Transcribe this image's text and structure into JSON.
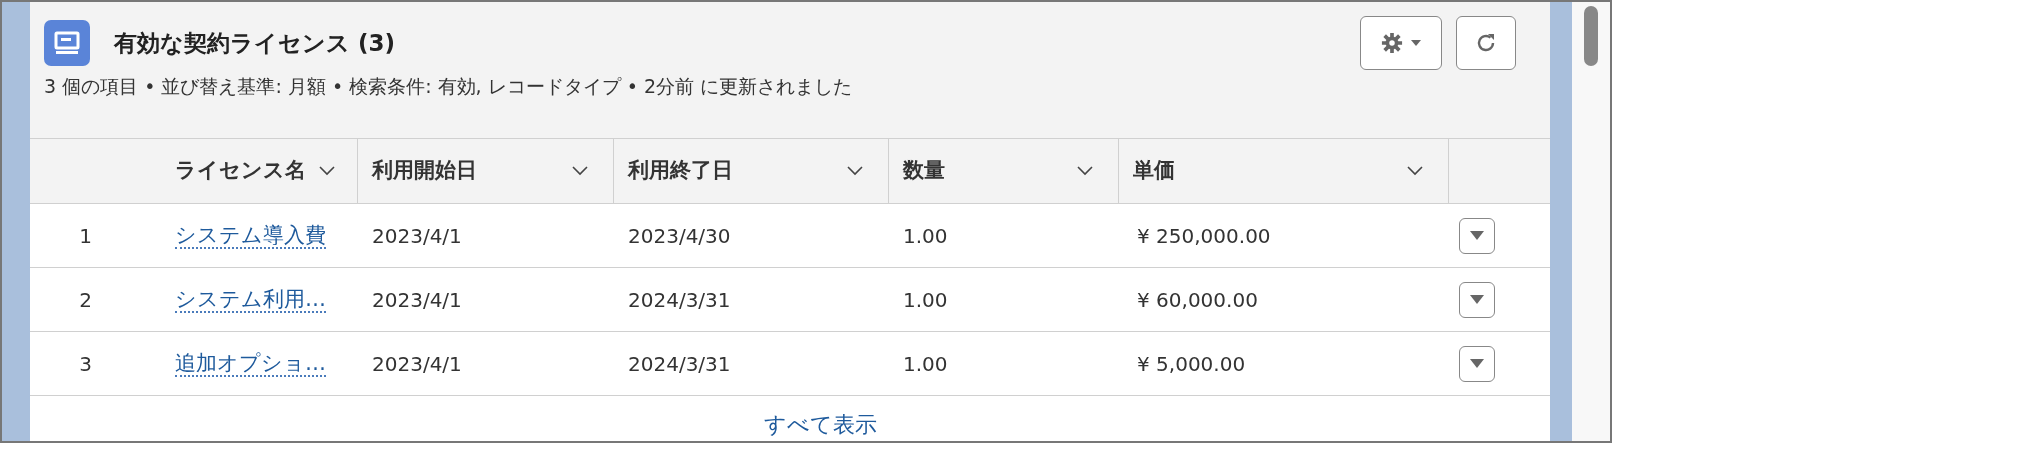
{
  "card": {
    "title": "有効な契約ライセンス (3)",
    "subtitle": "3 個の項目 • 並び替え基準: 月額 • 検索条件: 有効, レコードタイプ • 2分前 に更新されました"
  },
  "table": {
    "columns": [
      "ライセンス名",
      "利用開始日",
      "利用終了日",
      "数量",
      "単価"
    ],
    "rows": [
      {
        "number": "1",
        "name": "システム導入費",
        "start": "2023/4/1",
        "end": "2023/4/30",
        "quantity": "1.00",
        "price": "¥ 250,000.00"
      },
      {
        "number": "2",
        "name": "システム利用…",
        "start": "2023/4/1",
        "end": "2024/3/31",
        "quantity": "1.00",
        "price": "¥ 60,000.00"
      },
      {
        "number": "3",
        "name": "追加オプショ…",
        "start": "2023/4/1",
        "end": "2024/3/31",
        "quantity": "1.00",
        "price": "¥ 5,000.00"
      }
    ]
  },
  "footer": {
    "link": "すべて表示"
  }
}
